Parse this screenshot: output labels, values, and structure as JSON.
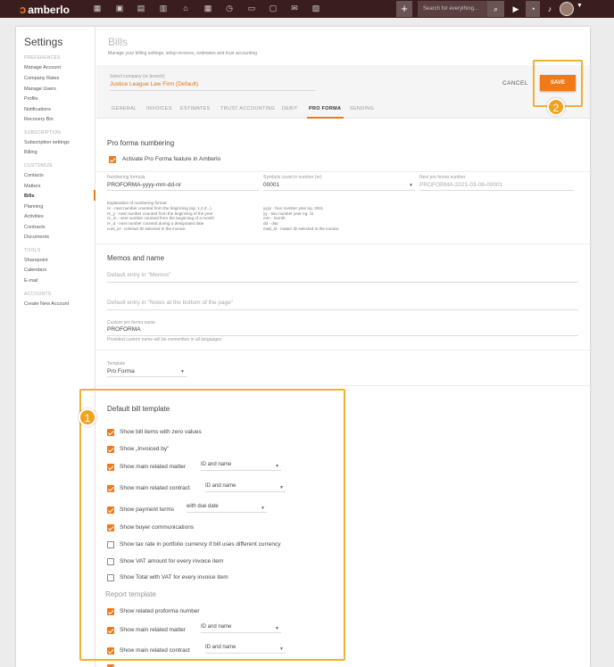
{
  "topbar": {
    "logo": "amberlo",
    "search_placeholder": "Search for everything...",
    "add_label": "+",
    "icons": [
      "dashboard-icon",
      "contacts-icon",
      "matters-icon",
      "documents-icon",
      "bank-icon",
      "calendar-icon",
      "time-icon",
      "folder-icon",
      "files-icon",
      "mail-icon",
      "reports-icon"
    ]
  },
  "sidebar": {
    "title": "Settings",
    "sections": [
      {
        "label": "PREFERENCES",
        "items": [
          "Manage Account",
          "Company Rates",
          "Manage Users",
          "Profile",
          "Notifications",
          "Recovery Bin"
        ]
      },
      {
        "label": "SUBSCRIPTION",
        "items": [
          "Subscription settings",
          "Billing"
        ]
      },
      {
        "label": "CUSTOMIZE",
        "items": [
          "Contacts",
          "Matters",
          "Bills",
          "Planning",
          "Activities",
          "Contracts",
          "Documents"
        ]
      },
      {
        "label": "TOOLS",
        "items": [
          "Sharepoint",
          "Calendars",
          "E-mail"
        ]
      },
      {
        "label": "ACCOUNTS",
        "items": [
          "Create New Account"
        ]
      }
    ],
    "active": "Bills"
  },
  "header": {
    "title": "Bills",
    "subtitle": "Manage your billing settings, setup invoices, estimates and trust accounting"
  },
  "company": {
    "label": "Select company (or branch)",
    "value": "Justice League Law Firm (Default)",
    "cancel": "CANCEL",
    "save": "SAVE"
  },
  "tabs": [
    "GENERAL",
    "INVOICES",
    "ESTIMATES",
    "TRUST ACCOUNTING",
    "DEBIT",
    "PRO FORMA",
    "SENDING"
  ],
  "active_tab": "PRO FORMA",
  "numbering": {
    "title": "Pro forma numbering",
    "activate_label": "Activate Pro Forma feature in Amberlo",
    "formula_label": "Numbering formula",
    "formula_value": "PROFORMA-yyyy-mm-dd-nr",
    "symbols_label": "Symbols count in number (nr)",
    "symbols_value": "00001",
    "next_label": "Next pro forma number",
    "next_value": "PROFORMA-2021-03-06-00001",
    "expl_left": "Explanation of numbering format:\nnr - next number counted from the beginning (eg. 1,2,3...)\nnr_y - next number counted from the beginning of the year\nnr_m - next number counted from the beginning of a month\nnr_d - next number counted during a designated date\ncont_id - contract ID selected in the invoice",
    "expl_right": "\nyyyy - four number year eg. 2011\nyy - two number year eg. 11\nmm - month\ndd - day\nmatt_id - matter ID selected in the invoice"
  },
  "memos": {
    "title": "Memos and name",
    "memos_placeholder": "Default entry in \"Memos\"",
    "notes_placeholder": "Default entry in \"Notes at the bottom of the page\"",
    "custom_label": "Custom pro forma name",
    "custom_value": "PROFORMA",
    "custom_hint": "Provided custom name will be overwritten in all languages"
  },
  "template": {
    "label": "Template",
    "value": "Pro Forma"
  },
  "bill_template": {
    "title": "Default bill template",
    "options": [
      {
        "label": "Show bill items with zero values",
        "checked": true
      },
      {
        "label": "Show „Invoiced by”",
        "checked": true
      },
      {
        "label": "Show main related matter",
        "checked": true,
        "select": "ID and name"
      },
      {
        "label": "Show main related contract",
        "checked": true,
        "select": "ID and name"
      },
      {
        "label": "Show payment terms",
        "checked": true,
        "select": "with due date"
      },
      {
        "label": "Show buyer communications",
        "checked": true
      },
      {
        "label": "Show tax rate in portfolio currency if bill uses different currency",
        "checked": false
      },
      {
        "label": "Show VAT amount for every invoice item",
        "checked": false
      },
      {
        "label": "Show Total with VAT for every invoice item",
        "checked": false
      }
    ]
  },
  "report_template": {
    "title": "Report template",
    "options": [
      {
        "label": "Show related proforma number",
        "checked": true
      },
      {
        "label": "Show main related matter",
        "checked": true,
        "select": "ID and name"
      },
      {
        "label": "Show main related contract",
        "checked": true,
        "select": "ID and name"
      }
    ]
  },
  "callouts": [
    "1",
    "2"
  ],
  "colors": {
    "accent": "#f07a1a",
    "topbar": "#3a1e1e",
    "highlight": "#f0b030"
  }
}
